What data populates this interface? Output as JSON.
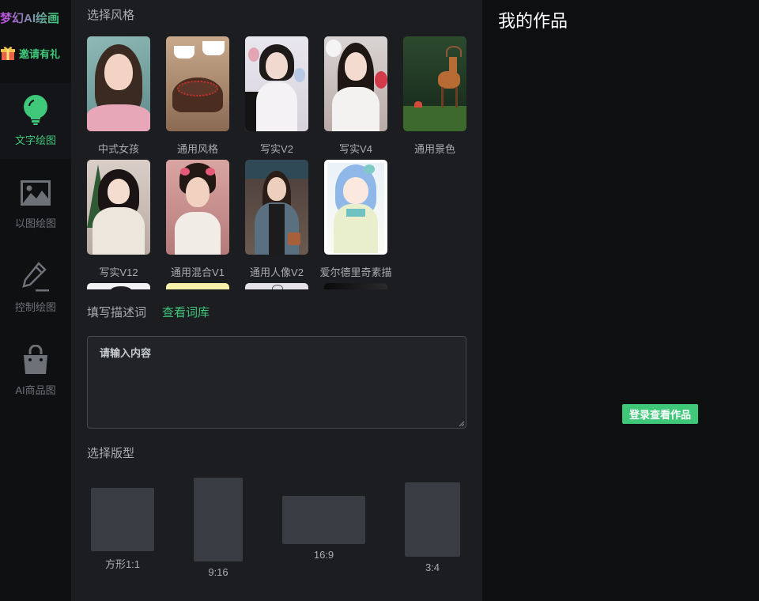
{
  "brand": {
    "name": "梦幻AI绘画"
  },
  "invite": {
    "label": "邀请有礼"
  },
  "nav": [
    {
      "label": "文字绘图",
      "icon": "lightbulb-icon",
      "active": true
    },
    {
      "label": "以图绘图",
      "icon": "image-icon",
      "active": false
    },
    {
      "label": "控制绘图",
      "icon": "pen-icon",
      "active": false
    },
    {
      "label": "AI商品图",
      "icon": "shopping-bag-icon",
      "active": false
    }
  ],
  "style_section": {
    "title": "选择风格",
    "styles": [
      {
        "label": "中式女孩"
      },
      {
        "label": "通用风格"
      },
      {
        "label": "写实V2"
      },
      {
        "label": "写实V4"
      },
      {
        "label": "通用景色"
      },
      {
        "label": "写实V12"
      },
      {
        "label": "通用混合V1"
      },
      {
        "label": "通用人像V2"
      },
      {
        "label": "爱尔德里奇素描"
      }
    ]
  },
  "prompt": {
    "label": "填写描述词",
    "library_link": "查看词库",
    "placeholder": "请输入内容"
  },
  "format_section": {
    "title": "选择版型",
    "formats": [
      {
        "label": "方形1:1"
      },
      {
        "label": "9:16"
      },
      {
        "label": "16:9"
      },
      {
        "label": "3:4"
      }
    ]
  },
  "works": {
    "title": "我的作品",
    "login_button": "登录查看作品"
  },
  "colors": {
    "accent": "#3fc77a",
    "brand_gradient_start": "#c24be3",
    "panel_bg": "#1c1d20",
    "page_bg": "#0e0f11"
  }
}
